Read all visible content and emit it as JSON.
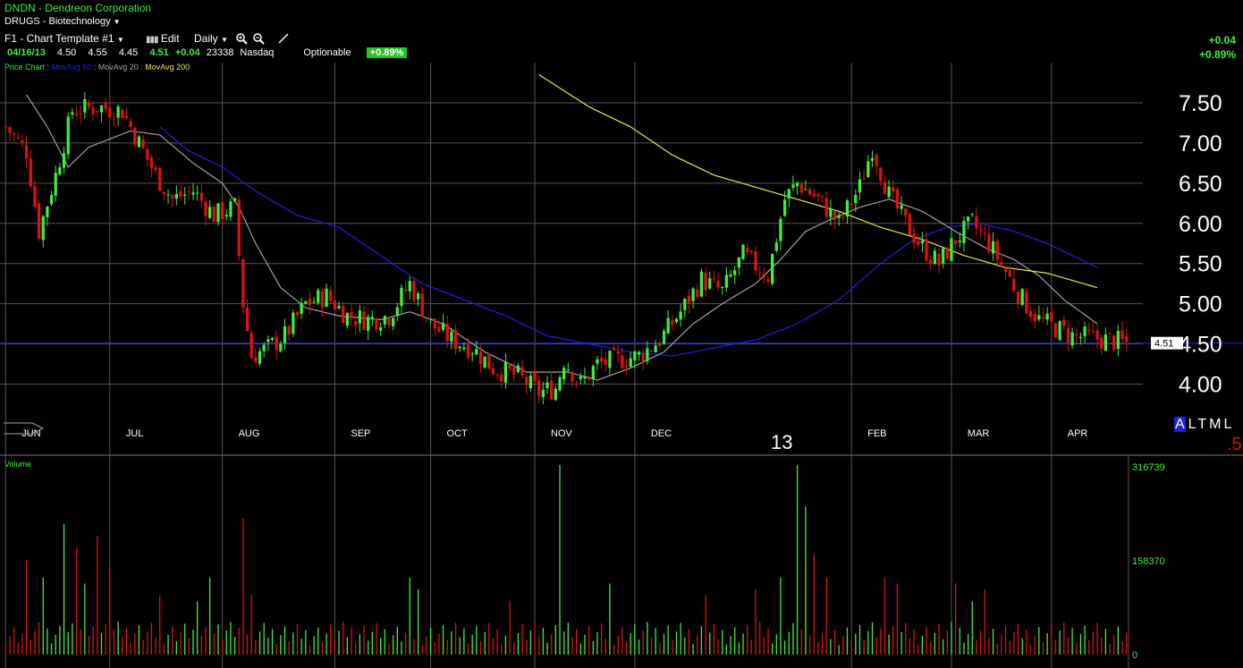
{
  "header": {
    "symbol": "DNDN",
    "separator": " - ",
    "company": "Dendreon Corporation",
    "group": "DRUGS - Biotechnology",
    "template_label": "F1 - Chart Template #1",
    "edit_label": "Edit",
    "period_label": "Daily",
    "change_abs": "+0.04",
    "change_pct": "+0.89%"
  },
  "quote": {
    "date": "04/16/13",
    "open": "4.50",
    "high": "4.55",
    "low": "4.45",
    "last": "4.51",
    "change": "+0.04",
    "volume": "23338",
    "exchange": "Nasdaq",
    "optionable": "Optionable",
    "pct_badge": "+0.89%"
  },
  "legend": {
    "price_chart": "Price Chart",
    "ma50": "MovAvg 50",
    "ma20": "MovAvg 20",
    "ma200": "MovAvg 200",
    "colors": {
      "price_chart": "#3cf03c",
      "ma50": "#2020e0",
      "ma20": "#a0a0a0",
      "ma200": "#e8e840"
    }
  },
  "altml": {
    "a": "A",
    "l": "L",
    "t": "T",
    "m": "M",
    "l2": "L"
  },
  "year_label": "13",
  "corner_label": ".5",
  "last_price_label": "4.51",
  "volume_title": "Volume",
  "chart_data": [
    {
      "type": "candlestick",
      "title": "",
      "y_ticks": [
        "7.50",
        "7.00",
        "6.50",
        "6.00",
        "5.50",
        "5.00",
        "4.50",
        "4.00"
      ],
      "y_tick_values": [
        7.5,
        7.0,
        6.5,
        6.0,
        5.5,
        5.0,
        4.5,
        4.0
      ],
      "ylim": [
        3.55,
        8.0
      ],
      "x_labels": [
        "JUN",
        "JUL",
        "AUG",
        "SEP",
        "OCT",
        "NOV",
        "DEC",
        "FEB",
        "MAR",
        "APR"
      ],
      "x_label_days": [
        6,
        31,
        58,
        85,
        108,
        133,
        157,
        209,
        233,
        257
      ],
      "year_marker": "13",
      "num_days": 270,
      "last_price": 4.51,
      "grid": true,
      "up_color": "#3cf03c",
      "down_color": "#e01010",
      "price_anchors": [
        [
          0,
          7.2
        ],
        [
          5,
          6.9
        ],
        [
          8,
          5.9
        ],
        [
          12,
          6.6
        ],
        [
          16,
          7.4
        ],
        [
          22,
          7.45
        ],
        [
          28,
          7.4
        ],
        [
          32,
          7.0
        ],
        [
          36,
          6.6
        ],
        [
          40,
          6.3
        ],
        [
          45,
          6.4
        ],
        [
          50,
          6.1
        ],
        [
          55,
          6.2
        ],
        [
          57,
          5.0
        ],
        [
          59,
          4.35
        ],
        [
          63,
          4.45
        ],
        [
          67,
          4.6
        ],
        [
          72,
          5.0
        ],
        [
          77,
          5.1
        ],
        [
          82,
          4.85
        ],
        [
          87,
          4.8
        ],
        [
          92,
          4.85
        ],
        [
          97,
          5.25
        ],
        [
          102,
          4.75
        ],
        [
          107,
          4.55
        ],
        [
          112,
          4.45
        ],
        [
          117,
          4.2
        ],
        [
          123,
          4.1
        ],
        [
          128,
          3.9
        ],
        [
          132,
          3.95
        ],
        [
          134,
          4.3
        ],
        [
          138,
          4.0
        ],
        [
          142,
          4.25
        ],
        [
          147,
          4.3
        ],
        [
          152,
          4.35
        ],
        [
          157,
          4.55
        ],
        [
          162,
          4.9
        ],
        [
          167,
          5.3
        ],
        [
          172,
          5.15
        ],
        [
          177,
          5.6
        ],
        [
          183,
          5.35
        ],
        [
          187,
          6.3
        ],
        [
          190,
          6.5
        ],
        [
          195,
          6.3
        ],
        [
          200,
          6.0
        ],
        [
          205,
          6.45
        ],
        [
          208,
          6.95
        ],
        [
          212,
          6.35
        ],
        [
          216,
          6.0
        ],
        [
          220,
          5.7
        ],
        [
          224,
          5.5
        ],
        [
          228,
          5.8
        ],
        [
          232,
          6.0
        ],
        [
          236,
          5.75
        ],
        [
          240,
          5.4
        ],
        [
          244,
          5.05
        ],
        [
          248,
          4.8
        ],
        [
          252,
          4.7
        ],
        [
          256,
          4.6
        ],
        [
          260,
          4.58
        ],
        [
          264,
          4.55
        ],
        [
          269,
          4.51
        ]
      ],
      "ma20_anchors": [
        [
          5,
          7.6
        ],
        [
          10,
          7.2
        ],
        [
          15,
          6.7
        ],
        [
          20,
          6.95
        ],
        [
          30,
          7.15
        ],
        [
          37,
          7.1
        ],
        [
          45,
          6.75
        ],
        [
          52,
          6.5
        ],
        [
          56,
          6.2
        ],
        [
          60,
          5.75
        ],
        [
          66,
          5.2
        ],
        [
          72,
          4.95
        ],
        [
          80,
          4.85
        ],
        [
          90,
          4.8
        ],
        [
          97,
          4.9
        ],
        [
          105,
          4.75
        ],
        [
          115,
          4.4
        ],
        [
          125,
          4.15
        ],
        [
          135,
          4.15
        ],
        [
          142,
          4.05
        ],
        [
          150,
          4.2
        ],
        [
          158,
          4.4
        ],
        [
          165,
          4.75
        ],
        [
          172,
          5.0
        ],
        [
          180,
          5.25
        ],
        [
          186,
          5.55
        ],
        [
          192,
          5.9
        ],
        [
          198,
          6.05
        ],
        [
          205,
          6.2
        ],
        [
          212,
          6.3
        ],
        [
          220,
          6.15
        ],
        [
          228,
          5.9
        ],
        [
          235,
          5.7
        ],
        [
          242,
          5.55
        ],
        [
          248,
          5.35
        ],
        [
          254,
          5.05
        ],
        [
          262,
          4.75
        ]
      ],
      "ma50_anchors": [
        [
          37,
          7.2
        ],
        [
          44,
          6.9
        ],
        [
          52,
          6.7
        ],
        [
          60,
          6.4
        ],
        [
          70,
          6.1
        ],
        [
          80,
          5.95
        ],
        [
          90,
          5.6
        ],
        [
          100,
          5.25
        ],
        [
          110,
          5.05
        ],
        [
          120,
          4.85
        ],
        [
          130,
          4.6
        ],
        [
          140,
          4.5
        ],
        [
          150,
          4.4
        ],
        [
          160,
          4.35
        ],
        [
          170,
          4.45
        ],
        [
          180,
          4.55
        ],
        [
          190,
          4.75
        ],
        [
          200,
          5.05
        ],
        [
          210,
          5.5
        ],
        [
          218,
          5.8
        ],
        [
          226,
          5.95
        ],
        [
          234,
          6.0
        ],
        [
          242,
          5.9
        ],
        [
          250,
          5.75
        ],
        [
          262,
          5.45
        ]
      ],
      "ma200_anchors": [
        [
          128,
          7.85
        ],
        [
          140,
          7.45
        ],
        [
          150,
          7.2
        ],
        [
          160,
          6.85
        ],
        [
          170,
          6.6
        ],
        [
          180,
          6.45
        ],
        [
          190,
          6.3
        ],
        [
          200,
          6.15
        ],
        [
          210,
          5.95
        ],
        [
          220,
          5.8
        ],
        [
          230,
          5.6
        ],
        [
          240,
          5.45
        ],
        [
          250,
          5.38
        ],
        [
          262,
          5.2
        ]
      ]
    },
    {
      "type": "bar",
      "title": "Volume",
      "y_ticks": [
        "316739",
        "158370",
        "0"
      ],
      "y_tick_values": [
        316739,
        158370,
        0
      ],
      "ylim": [
        0,
        316739
      ],
      "base_volume": 40000,
      "spikes": [
        [
          5,
          160000
        ],
        [
          9,
          130000
        ],
        [
          14,
          220000
        ],
        [
          17,
          180000
        ],
        [
          19,
          120000
        ],
        [
          22,
          200000
        ],
        [
          25,
          150000
        ],
        [
          37,
          100000
        ],
        [
          46,
          90000
        ],
        [
          49,
          130000
        ],
        [
          57,
          230000
        ],
        [
          59,
          100000
        ],
        [
          97,
          130000
        ],
        [
          99,
          110000
        ],
        [
          121,
          90000
        ],
        [
          133,
          320000
        ],
        [
          145,
          120000
        ],
        [
          168,
          100000
        ],
        [
          180,
          110000
        ],
        [
          186,
          130000
        ],
        [
          190,
          320000
        ],
        [
          192,
          250000
        ],
        [
          194,
          170000
        ],
        [
          197,
          130000
        ],
        [
          211,
          130000
        ],
        [
          214,
          120000
        ],
        [
          228,
          120000
        ],
        [
          232,
          90000
        ],
        [
          235,
          110000
        ]
      ]
    }
  ]
}
